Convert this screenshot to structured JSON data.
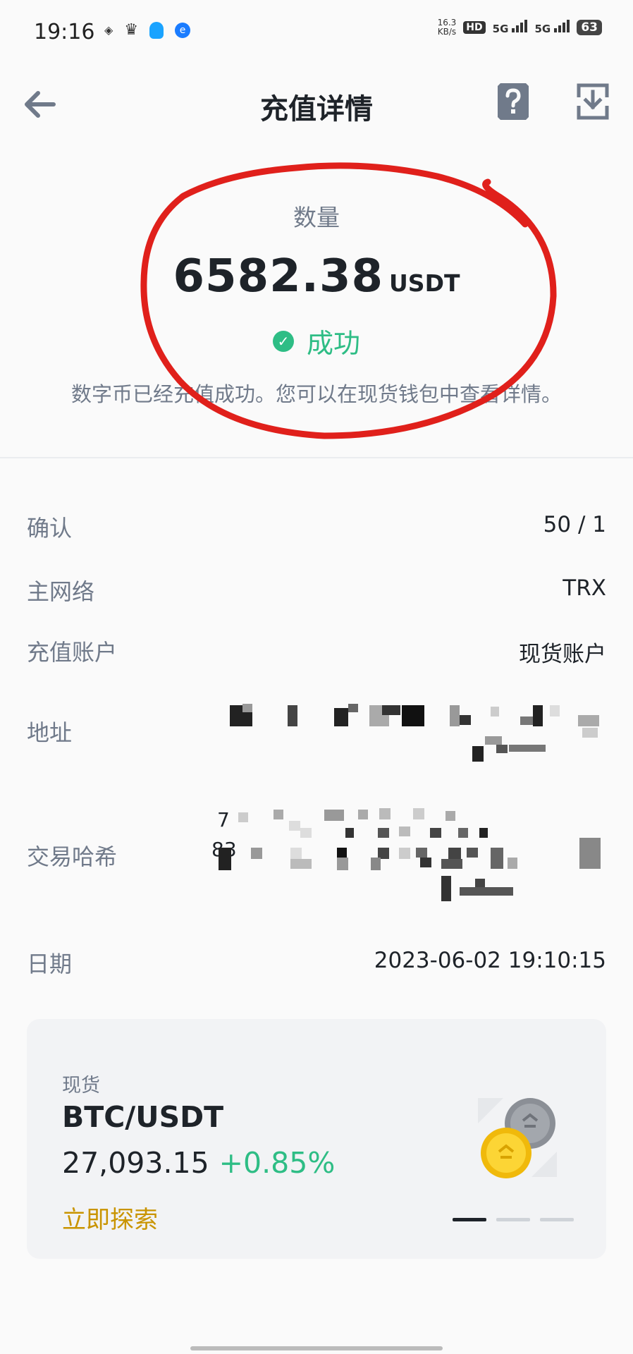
{
  "status_bar": {
    "time": "19:16",
    "net_speed_value": "16.3",
    "net_speed_unit": "KB/s",
    "hd": "HD",
    "signal_1": "5G",
    "signal_2": "5G",
    "battery": "63"
  },
  "header": {
    "title": "充值详情"
  },
  "summary": {
    "quantity_label": "数量",
    "amount": "6582.38",
    "unit": "USDT",
    "status": "成功",
    "description": "数字币已经充值成功。您可以在现货钱包中查看详情。"
  },
  "details": {
    "confirmations_label": "确认",
    "confirmations_value": "50 / 1",
    "network_label": "主网络",
    "network_value": "TRX",
    "account_label": "充值账户",
    "account_value": "现货账户",
    "address_label": "地址",
    "txhash_label": "交易哈希",
    "txhash_partial_1": "7",
    "txhash_partial_2": "83",
    "date_label": "日期",
    "date_value": "2023-06-02 19:10:15"
  },
  "promo": {
    "category": "现货",
    "pair": "BTC/USDT",
    "price": "27,093.15",
    "change": "+0.85%",
    "cta": "立即探索"
  },
  "colors": {
    "success": "#2ebd85",
    "accent": "#c99400",
    "annotation": "#e0201b"
  }
}
